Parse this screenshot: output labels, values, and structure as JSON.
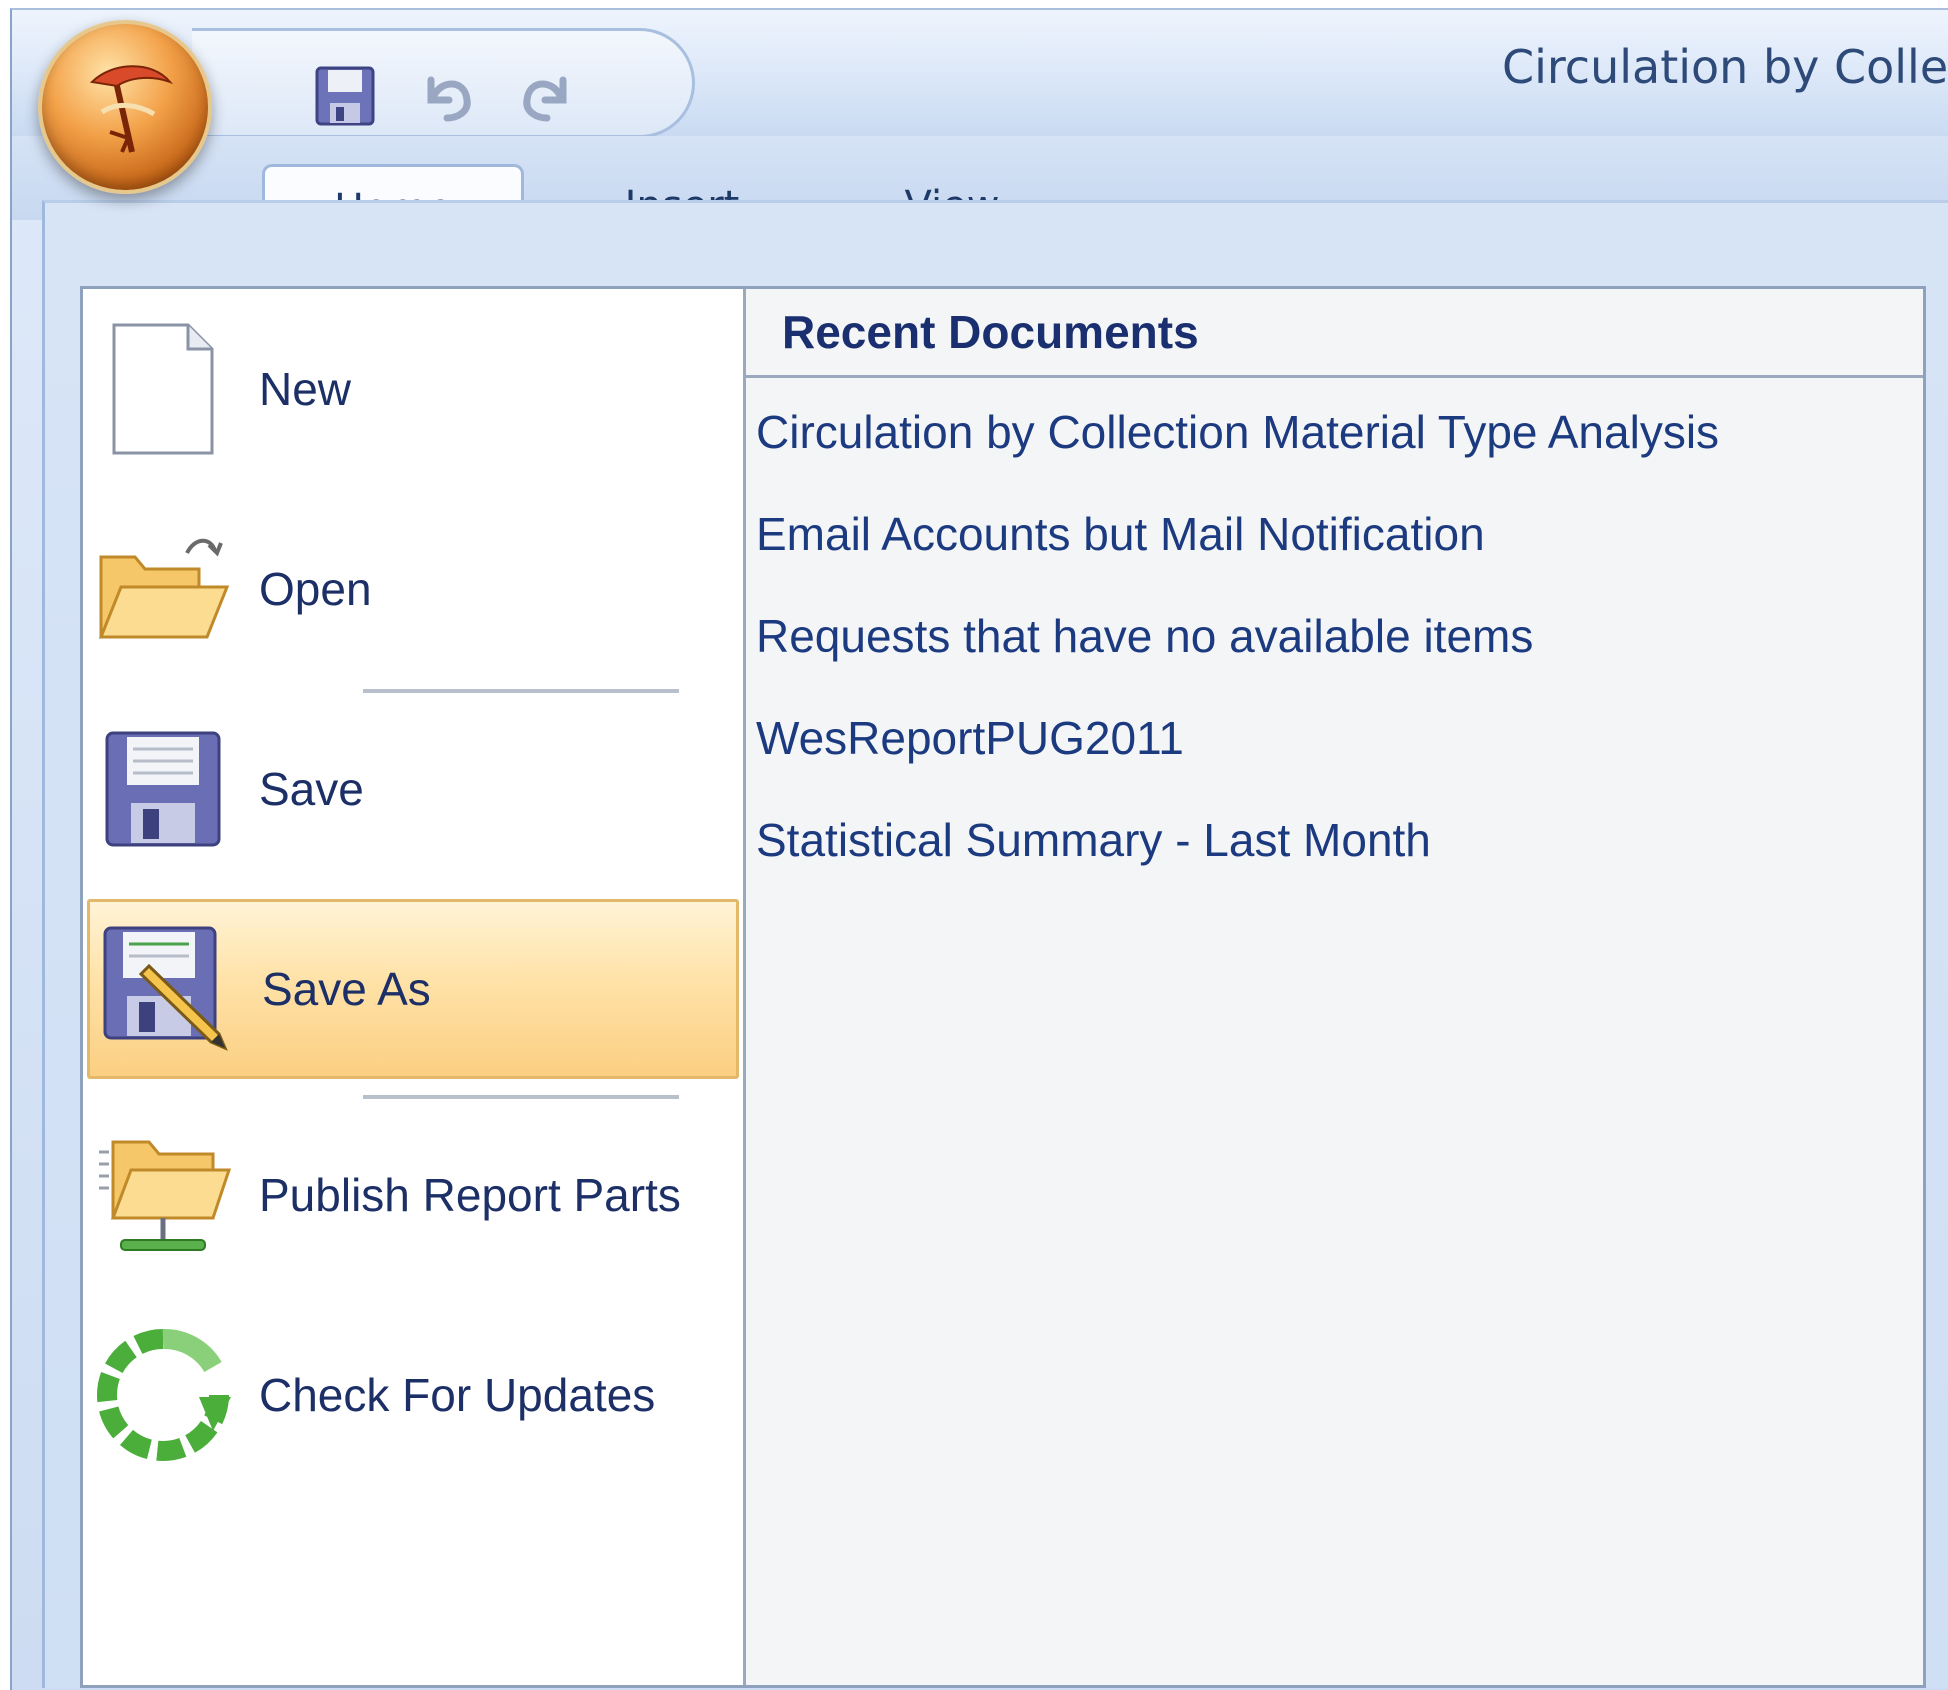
{
  "window": {
    "title": "Circulation by Colle"
  },
  "quick_access": [
    {
      "name": "save-icon"
    },
    {
      "name": "undo-icon"
    },
    {
      "name": "redo-icon"
    }
  ],
  "tabs": [
    {
      "label": "Home"
    },
    {
      "label": "Insert"
    },
    {
      "label": "View"
    }
  ],
  "menu": {
    "items": [
      {
        "label": "New",
        "icon": "new-document-icon"
      },
      {
        "label": "Open",
        "icon": "open-folder-icon"
      },
      {
        "label": "Save",
        "icon": "save-disk-icon"
      },
      {
        "label": "Save As",
        "icon": "save-as-icon",
        "highlighted": true
      },
      {
        "label": "Publish Report Parts",
        "icon": "publish-folder-icon"
      },
      {
        "label": "Check For Updates",
        "icon": "refresh-icon"
      }
    ]
  },
  "recent": {
    "title": "Recent Documents",
    "items": [
      "Circulation by Collection Material Type Analysis",
      "Email Accounts but Mail Notification",
      "Requests that have no available items",
      "WesReportPUG2011",
      "Statistical Summary - Last Month"
    ]
  },
  "colors": {
    "accent_text": "#1c3a80",
    "highlight": "#fbcf82",
    "ribbon_blue": "#cddcf2"
  }
}
